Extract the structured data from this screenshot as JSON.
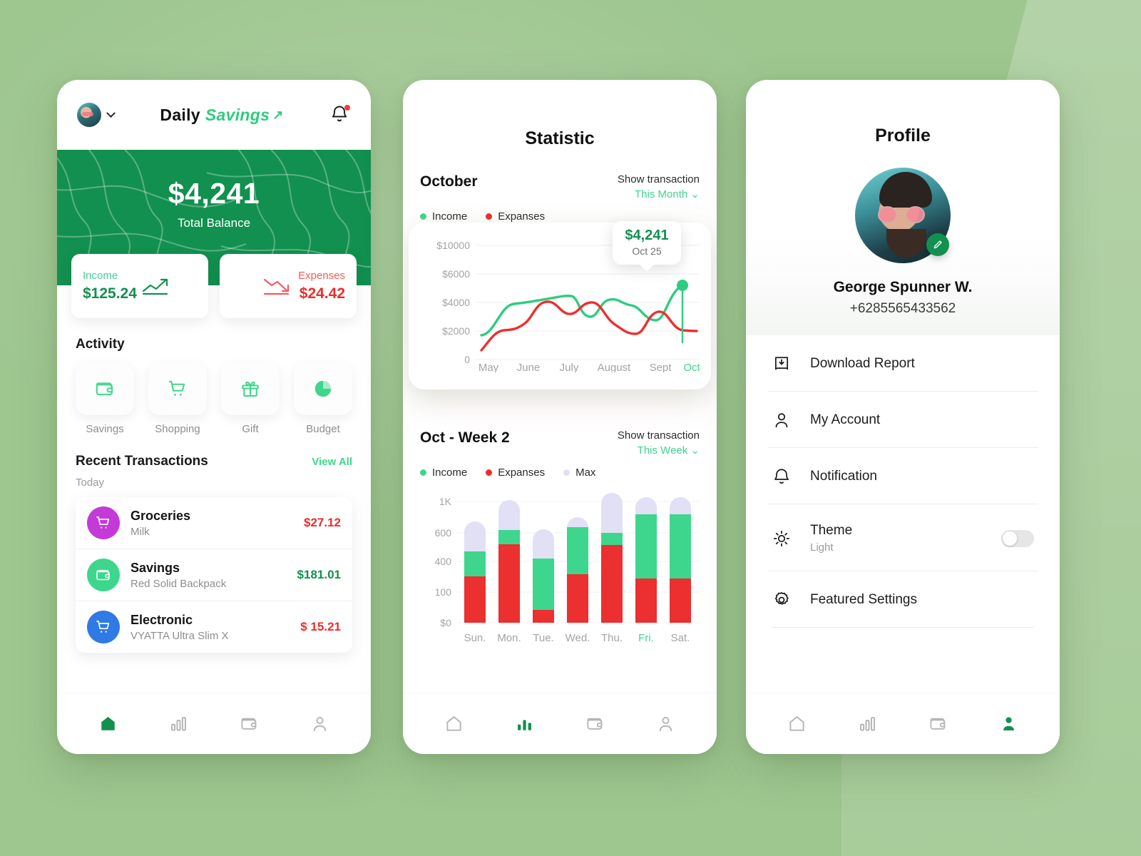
{
  "colors": {
    "brand_green_dark": "#12904f",
    "mint": "#3ed68c",
    "red": "#ef2b2b",
    "lavender": "#e2e0f5",
    "background": "#9ec68f"
  },
  "home": {
    "header": {
      "title_bold": "Daily",
      "title_italic": "Savings",
      "avatar_name": "avatar",
      "chevron": "chevron-down",
      "bell": "notification-bell"
    },
    "balance": {
      "amount": "$4,241",
      "label": "Total Balance"
    },
    "income": {
      "label": "Income",
      "value": "$125.24"
    },
    "expenses": {
      "label": "Expenses",
      "value": "$24.42"
    },
    "activity": {
      "title": "Activity",
      "items": [
        {
          "label": "Savings",
          "icon": "wallet-icon"
        },
        {
          "label": "Shopping",
          "icon": "cart-icon"
        },
        {
          "label": "Gift",
          "icon": "gift-icon"
        },
        {
          "label": "Budget",
          "icon": "pie-chart-icon"
        }
      ]
    },
    "recent": {
      "title": "Recent Transactions",
      "view_all": "View All",
      "day_label": "Today",
      "transactions": [
        {
          "name": "Groceries",
          "sub": "Milk",
          "amount": "$27.12",
          "amount_color": "#ef2b2b",
          "icon": "cart-icon",
          "icon_bg": "#c33ad8"
        },
        {
          "name": "Savings",
          "sub": "Red Solid Backpack",
          "amount": "$181.01",
          "amount_color": "#12904f",
          "icon": "wallet-icon",
          "icon_bg": "#3ed68c"
        },
        {
          "name": "Electronic",
          "sub": "VYATTA Ultra Slim X",
          "amount": "$ 15.21",
          "amount_color": "#ef2b2b",
          "icon": "cart-icon",
          "icon_bg": "#2f7ae5"
        }
      ]
    },
    "nav": {
      "active": "home",
      "items": [
        "home-icon",
        "bar-chart-icon",
        "wallet-icon",
        "person-icon"
      ]
    }
  },
  "stats": {
    "title": "Statistic",
    "line_section": {
      "title": "October",
      "show_label": "Show transaction",
      "period": "This Month",
      "legend": [
        {
          "label": "Income",
          "color": "#3ed68c"
        },
        {
          "label": "Expanses",
          "color": "#ef2b2b"
        }
      ],
      "tooltip": {
        "value": "$4,241",
        "date": "Oct 25"
      }
    },
    "bar_section": {
      "title": "Oct - Week 2",
      "show_label": "Show transaction",
      "period": "This Week",
      "legend": [
        {
          "label": "Income",
          "color": "#3ed68c"
        },
        {
          "label": "Expanses",
          "color": "#ef2b2b"
        },
        {
          "label": "Max",
          "color": "#e2e0f5"
        }
      ]
    },
    "nav": {
      "active": "bar-chart",
      "items": [
        "home-icon",
        "bar-chart-icon",
        "wallet-icon",
        "person-icon"
      ]
    }
  },
  "chart_data": [
    {
      "type": "line",
      "title": "October",
      "xlabel": "",
      "ylabel": "",
      "x": [
        "May",
        "June",
        "July",
        "August",
        "Sept",
        "Oct"
      ],
      "tick_labels_y": [
        "0",
        "$2000",
        "$4000",
        "$6000",
        "$10000"
      ],
      "ylim": [
        0,
        10000
      ],
      "grid": true,
      "legend_position": "top-left",
      "highlight_x": "Oct",
      "annotation": {
        "value": "$4,241",
        "date": "Oct 25"
      },
      "series": [
        {
          "name": "Income",
          "color": "#3ed68c",
          "values": [
            2700,
            4300,
            4700,
            4300,
            4500,
            5000
          ]
        },
        {
          "name": "Expanses",
          "color": "#ef2b2b",
          "values": [
            1800,
            4200,
            4000,
            2900,
            3900,
            2700
          ]
        }
      ]
    },
    {
      "type": "bar",
      "title": "Oct - Week 2",
      "xlabel": "",
      "ylabel": "",
      "categories": [
        "Sun.",
        "Mon.",
        "Tue.",
        "Wed.",
        "Thu.",
        "Fri.",
        "Sat."
      ],
      "tick_labels_y": [
        "$0",
        "100",
        "400",
        "600",
        "1K"
      ],
      "ylim": [
        0,
        1000
      ],
      "grid": true,
      "stacked": true,
      "highlight_category": "Fri.",
      "legend_position": "top-left",
      "series": [
        {
          "name": "Expanses",
          "color": "#ef2b2b",
          "values": [
            215,
            420,
            40,
            250,
            425,
            205,
            205
          ]
        },
        {
          "name": "Income",
          "color": "#3ed68c",
          "values": [
            295,
            150,
            340,
            410,
            165,
            555,
            555
          ]
        },
        {
          "name": "Max",
          "color": "#e2e0f5",
          "values": [
            190,
            430,
            250,
            75,
            410,
            240,
            240
          ]
        }
      ]
    }
  ],
  "profile": {
    "title": "Profile",
    "name": "George Spunner W.",
    "phone": "+6285565433562",
    "edit_icon": "pencil-icon",
    "menu": [
      {
        "label": "Download Report",
        "icon": "download-report-icon",
        "sub": null,
        "toggle": null
      },
      {
        "label": "My Account",
        "icon": "person-icon",
        "sub": null,
        "toggle": null
      },
      {
        "label": "Notification",
        "icon": "bell-icon",
        "sub": null,
        "toggle": null
      },
      {
        "label": "Theme",
        "icon": "sun-icon",
        "sub": "Light",
        "toggle": "off"
      },
      {
        "label": "Featured Settings",
        "icon": "gear-icon",
        "sub": null,
        "toggle": null
      }
    ],
    "nav": {
      "active": "person",
      "items": [
        "home-icon",
        "bar-chart-icon",
        "wallet-icon",
        "person-icon"
      ]
    }
  }
}
